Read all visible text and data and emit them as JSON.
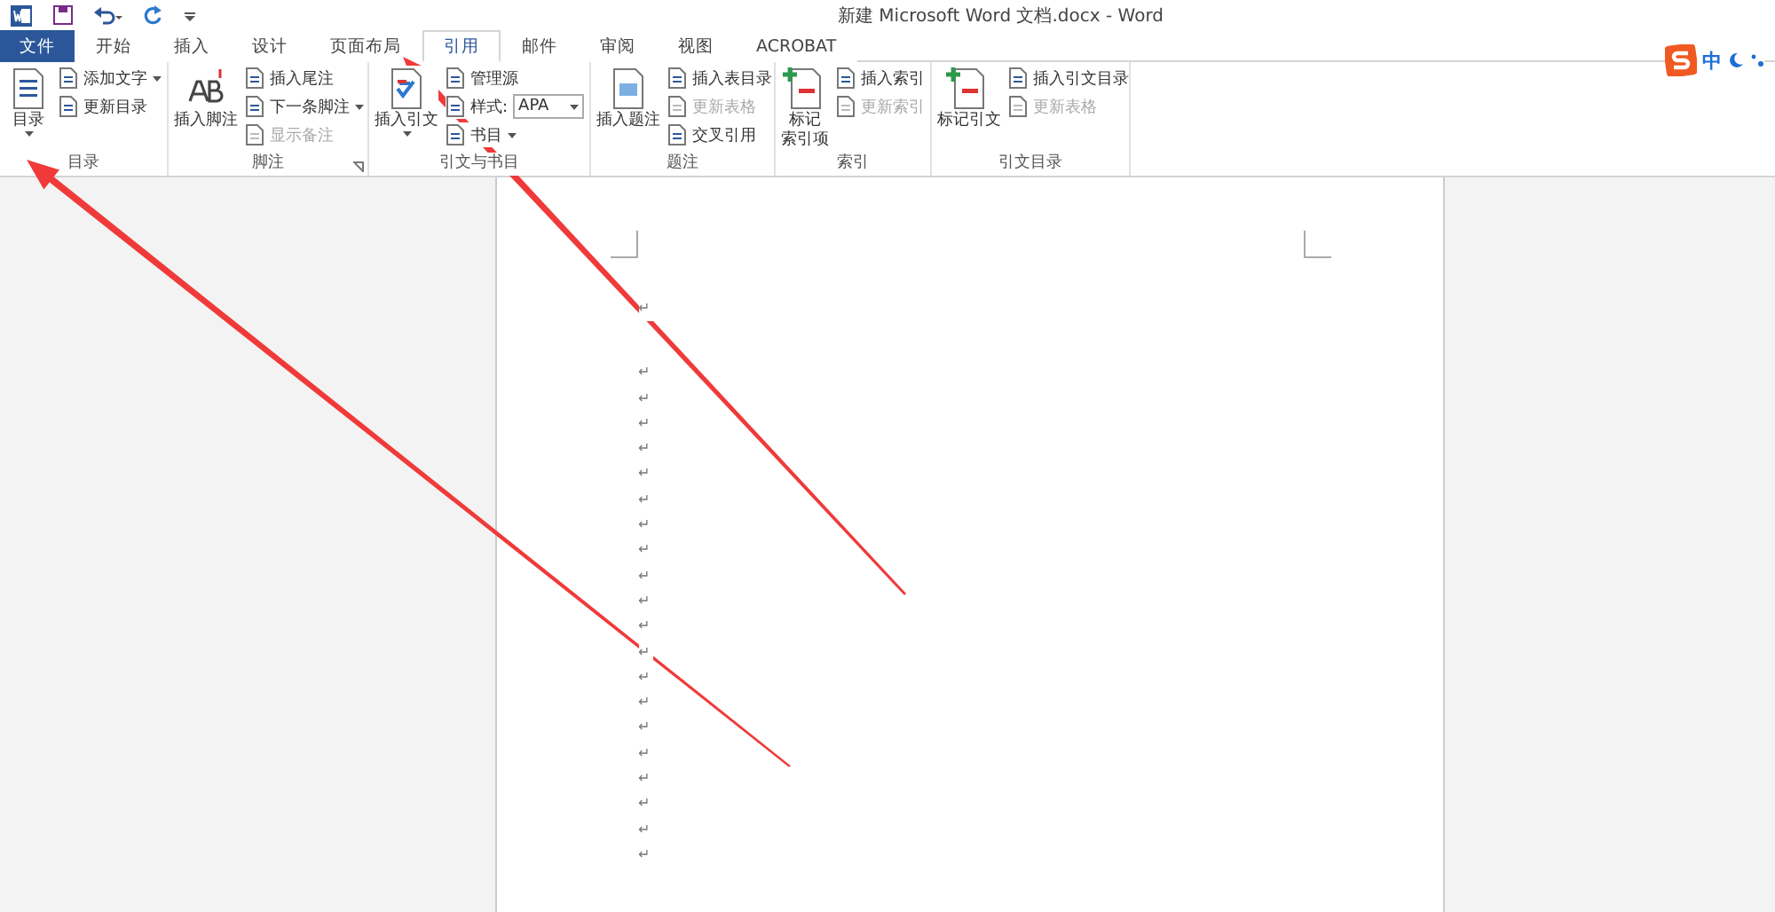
{
  "window": {
    "title": "新建 Microsoft Word 文档.docx - Word"
  },
  "tabs": [
    {
      "label": "文件",
      "kind": "file",
      "selected": false
    },
    {
      "label": "开始",
      "kind": "tab",
      "selected": false
    },
    {
      "label": "插入",
      "kind": "tab",
      "selected": false
    },
    {
      "label": "设计",
      "kind": "tab",
      "selected": false
    },
    {
      "label": "页面布局",
      "kind": "tab",
      "selected": false
    },
    {
      "label": "引用",
      "kind": "tab",
      "selected": true
    },
    {
      "label": "邮件",
      "kind": "tab",
      "selected": false
    },
    {
      "label": "审阅",
      "kind": "tab",
      "selected": false
    },
    {
      "label": "视图",
      "kind": "tab",
      "selected": false
    },
    {
      "label": "ACROBAT",
      "kind": "tab",
      "selected": false
    }
  ],
  "groups": [
    {
      "label": "目录",
      "launcher": false,
      "large": {
        "label": "目录",
        "caret": true
      },
      "items": [
        {
          "label": "添加文字",
          "kind": "dropdown",
          "disabled": false
        },
        {
          "label": "更新目录",
          "kind": "button",
          "disabled": false
        }
      ]
    },
    {
      "label": "脚注",
      "launcher": true,
      "large": {
        "label": "插入脚注",
        "caret": false
      },
      "items": [
        {
          "label": "插入尾注",
          "kind": "button",
          "disabled": false
        },
        {
          "label": "下一条脚注",
          "kind": "dropdown",
          "disabled": false
        },
        {
          "label": "显示备注",
          "kind": "button",
          "disabled": true
        }
      ]
    },
    {
      "label": "引文与书目",
      "launcher": false,
      "large": {
        "label": "插入引文",
        "caret": true
      },
      "items": [
        {
          "label": "管理源",
          "kind": "button",
          "disabled": false
        },
        {
          "label": "样式:",
          "kind": "combo",
          "value": "APA",
          "disabled": false
        },
        {
          "label": "书目",
          "kind": "dropdown",
          "disabled": false
        }
      ]
    },
    {
      "label": "题注",
      "launcher": false,
      "large": {
        "label": "插入题注",
        "caret": false
      },
      "items": [
        {
          "label": "插入表目录",
          "kind": "button",
          "disabled": false
        },
        {
          "label": "更新表格",
          "kind": "button",
          "disabled": true
        },
        {
          "label": "交叉引用",
          "kind": "button",
          "disabled": false
        }
      ]
    },
    {
      "label": "索引",
      "launcher": false,
      "large": {
        "label": "标记",
        "label_2": "索引项",
        "caret": false
      },
      "items": [
        {
          "label": "插入索引",
          "kind": "button",
          "disabled": false
        },
        {
          "label": "更新索引",
          "kind": "button",
          "disabled": true
        }
      ]
    },
    {
      "label": "引文目录",
      "launcher": false,
      "large": {
        "label": "标记引文",
        "caret": false
      },
      "items": [
        {
          "label": "插入引文目录",
          "kind": "button",
          "disabled": false
        },
        {
          "label": "更新表格",
          "kind": "button",
          "disabled": true
        }
      ]
    }
  ],
  "ime": {
    "mode": "中"
  },
  "paragraph_marks": [
    "↵",
    "↵",
    "↵",
    "↵",
    "↵",
    "↵",
    "↵",
    "↵",
    "↵",
    "↵",
    "↵",
    "↵",
    "↵",
    "↵",
    "↵",
    "↵",
    "↵",
    "↵",
    "↵",
    "↵",
    "↵"
  ]
}
